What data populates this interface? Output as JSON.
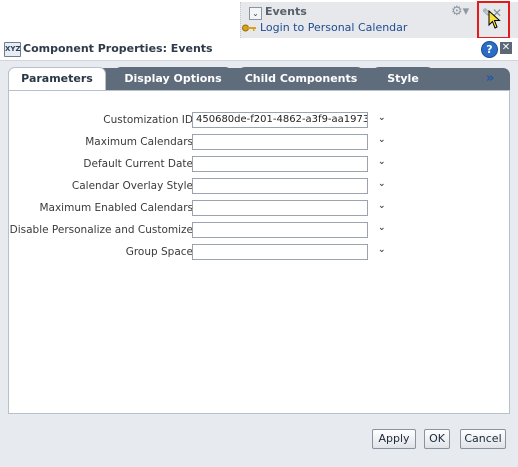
{
  "portlet": {
    "title": "Events",
    "login_link": "Login to Personal Calendar"
  },
  "dialog": {
    "title": "Component Properties: Events",
    "help_symbol": "?",
    "close_symbol": "✕",
    "icon_text": "XYZ"
  },
  "tabs": [
    {
      "label": "Parameters",
      "active": true
    },
    {
      "label": "Display Options",
      "active": false
    },
    {
      "label": "Child Components",
      "active": false
    },
    {
      "label": "Style",
      "active": false
    }
  ],
  "tabs_more": "»",
  "fields": [
    {
      "label": "Customization ID",
      "value": "450680de-f201-4862-a3f9-aa1973"
    },
    {
      "label": "Maximum Calendars",
      "value": ""
    },
    {
      "label": "Default Current Date",
      "value": ""
    },
    {
      "label": "Calendar Overlay Style",
      "value": ""
    },
    {
      "label": "Maximum Enabled Calendars",
      "value": ""
    },
    {
      "label": "Disable Personalize and Customize",
      "value": ""
    },
    {
      "label": "Group Space",
      "value": ""
    }
  ],
  "buttons": {
    "apply": "Apply",
    "ok": "OK",
    "cancel": "Cancel"
  },
  "colors": {
    "accent_blue": "#2b6cc4",
    "tab_inactive": "#5f6c7c",
    "highlight_red": "#e31b1b"
  }
}
